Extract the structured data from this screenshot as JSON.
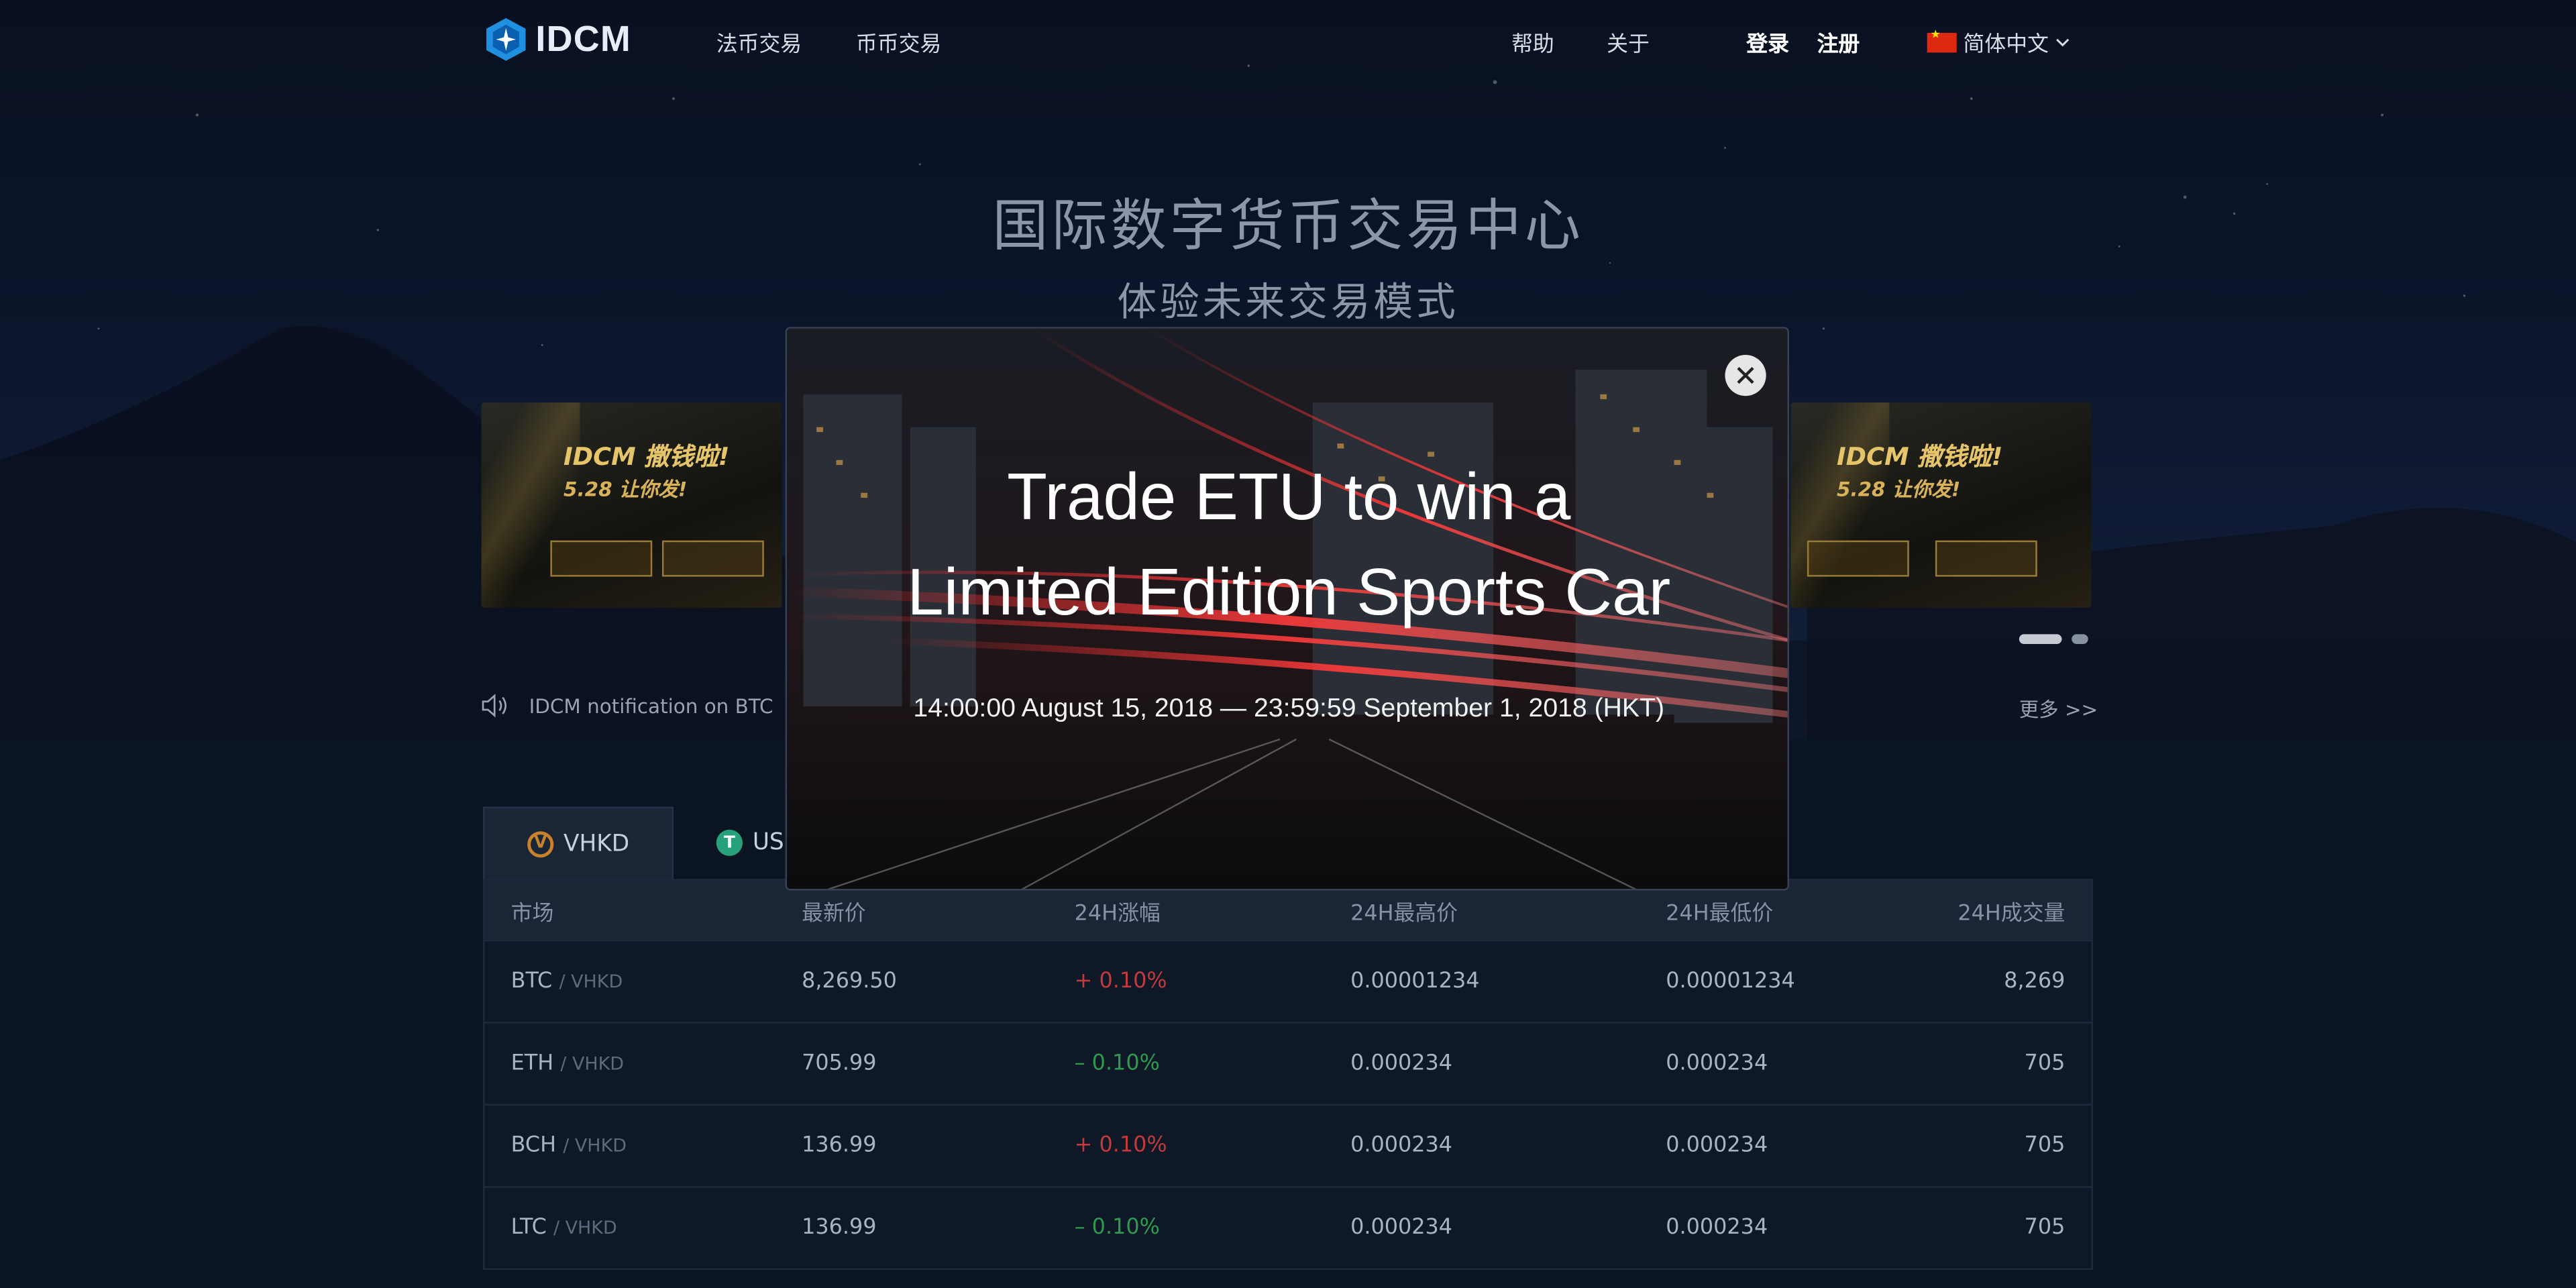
{
  "nav": {
    "logo": "IDCM",
    "links": [
      "法币交易",
      "币币交易"
    ],
    "help": "帮助",
    "about": "关于",
    "login": "登录",
    "register": "注册",
    "language": "简体中文"
  },
  "hero": {
    "title": "国际数字货币交易中心",
    "subtitle": "体验未来交易模式"
  },
  "banners": [
    {
      "title": "IDCM 撒钱啦!",
      "subtitle": "5.28 让你发!"
    },
    {
      "title": "IDCM 撒钱啦!",
      "subtitle": "5.28 让你发!"
    }
  ],
  "notice": {
    "text": "IDCM notification on BTC",
    "more": "更多  >>"
  },
  "tabs": [
    {
      "label": "VHKD",
      "icon": "vhkd-coin-icon",
      "active": true
    },
    {
      "label": "USDT",
      "icon": "usdt-coin-icon",
      "active": false
    }
  ],
  "table": {
    "headers": [
      "市场",
      "最新价",
      "24H涨幅",
      "24H最高价",
      "24H最低价",
      "24H成交量"
    ],
    "rows": [
      {
        "base": "BTC",
        "quote": "/ VHKD",
        "price": "8,269.50",
        "change": "+ 0.10%",
        "dir": "up",
        "high": "0.00001234",
        "low": "0.00001234",
        "volume": "8,269"
      },
      {
        "base": "ETH",
        "quote": "/ VHKD",
        "price": "705.99",
        "change": "– 0.10%",
        "dir": "down",
        "high": "0.000234",
        "low": "0.000234",
        "volume": "705"
      },
      {
        "base": "BCH",
        "quote": "/ VHKD",
        "price": "136.99",
        "change": "+ 0.10%",
        "dir": "up",
        "high": "0.000234",
        "low": "0.000234",
        "volume": "705"
      },
      {
        "base": "LTC",
        "quote": "/ VHKD",
        "price": "136.99",
        "change": "– 0.10%",
        "dir": "down",
        "high": "0.000234",
        "low": "0.000234",
        "volume": "705"
      }
    ]
  },
  "modal": {
    "title_line1": "Trade ETU to win a",
    "title_line2": "Limited Edition Sports Car",
    "date_range": "14:00:00 August 15, 2018 — 23:59:59 September 1, 2018 (HKT)",
    "close_icon": "close-icon"
  },
  "colors": {
    "accent_up": "#c23a3a",
    "accent_down": "#2e9a4e",
    "coin_vhkd": "#c9822c",
    "coin_usdt": "#26a17b"
  }
}
